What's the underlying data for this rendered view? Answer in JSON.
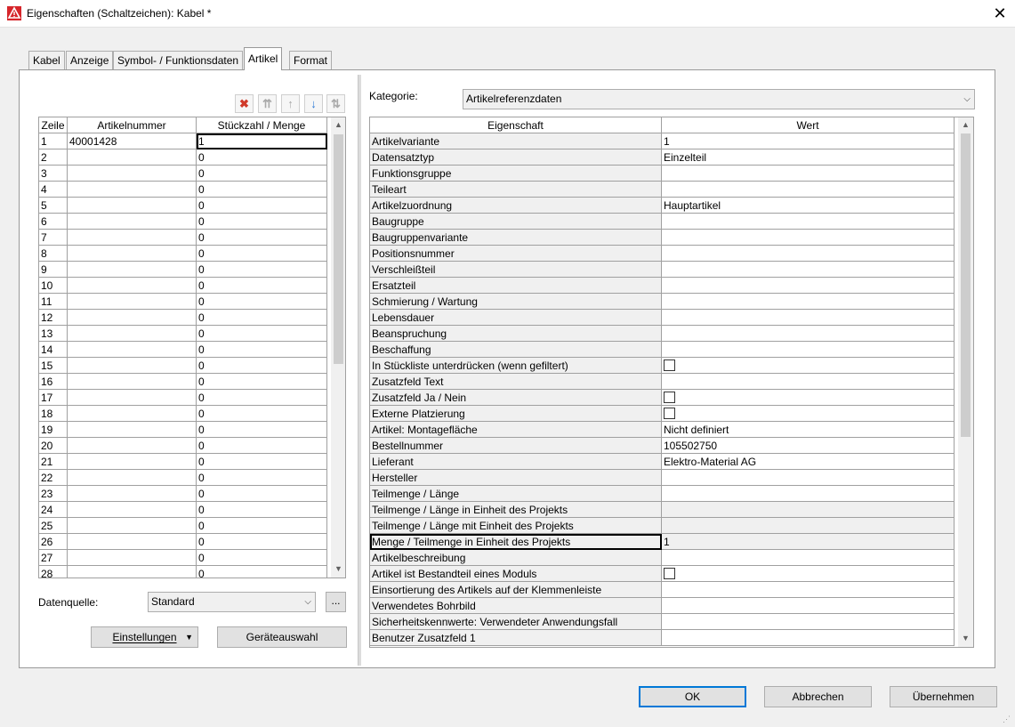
{
  "window": {
    "title": "Eigenschaften (Schaltzeichen): Kabel *",
    "close_glyph": "✕",
    "app_icon": "warning-triangle-icon"
  },
  "tabs": [
    {
      "label": "Kabel"
    },
    {
      "label": "Anzeige"
    },
    {
      "label": "Symbol- / Funktionsdaten"
    },
    {
      "label": "Artikel",
      "active": true
    },
    {
      "label": "Format"
    }
  ],
  "toolbar": {
    "delete_glyph": "✖",
    "move_top_glyph": "⇈",
    "move_up_glyph": "↑",
    "move_down_glyph": "↓",
    "swap_glyph": "⇅"
  },
  "article_grid": {
    "headers": [
      "Zeile",
      "Artikelnummer",
      "Stückzahl / Menge"
    ],
    "rows": [
      [
        "1",
        "40001428",
        "1"
      ],
      [
        "2",
        "",
        "0"
      ],
      [
        "3",
        "",
        "0"
      ],
      [
        "4",
        "",
        "0"
      ],
      [
        "5",
        "",
        "0"
      ],
      [
        "6",
        "",
        "0"
      ],
      [
        "7",
        "",
        "0"
      ],
      [
        "8",
        "",
        "0"
      ],
      [
        "9",
        "",
        "0"
      ],
      [
        "10",
        "",
        "0"
      ],
      [
        "11",
        "",
        "0"
      ],
      [
        "12",
        "",
        "0"
      ],
      [
        "13",
        "",
        "0"
      ],
      [
        "14",
        "",
        "0"
      ],
      [
        "15",
        "",
        "0"
      ],
      [
        "16",
        "",
        "0"
      ],
      [
        "17",
        "",
        "0"
      ],
      [
        "18",
        "",
        "0"
      ],
      [
        "19",
        "",
        "0"
      ],
      [
        "20",
        "",
        "0"
      ],
      [
        "21",
        "",
        "0"
      ],
      [
        "22",
        "",
        "0"
      ],
      [
        "23",
        "",
        "0"
      ],
      [
        "24",
        "",
        "0"
      ],
      [
        "25",
        "",
        "0"
      ],
      [
        "26",
        "",
        "0"
      ],
      [
        "27",
        "",
        "0"
      ],
      [
        "28",
        "",
        "0"
      ]
    ]
  },
  "datasource": {
    "label": "Datenquelle:",
    "value": "Standard",
    "browse_label": "..."
  },
  "buttons": {
    "settings": "Einstellungen",
    "device_selection": "Geräteauswahl",
    "ok": "OK",
    "cancel": "Abbrechen",
    "apply": "Übernehmen"
  },
  "category": {
    "label": "Kategorie:",
    "value": "Artikelreferenzdaten"
  },
  "property_grid": {
    "headers": [
      "Eigenschaft",
      "Wert"
    ],
    "rows": [
      {
        "name": "Artikelvariante",
        "value": "1"
      },
      {
        "name": "Datensatztyp",
        "value": "Einzelteil"
      },
      {
        "name": "Funktionsgruppe",
        "value": ""
      },
      {
        "name": "Teileart",
        "value": ""
      },
      {
        "name": "Artikelzuordnung",
        "value": "Hauptartikel"
      },
      {
        "name": "Baugruppe",
        "value": ""
      },
      {
        "name": "Baugruppenvariante",
        "value": ""
      },
      {
        "name": "Positionsnummer",
        "value": ""
      },
      {
        "name": "Verschleißteil",
        "value": ""
      },
      {
        "name": "Ersatzteil",
        "value": ""
      },
      {
        "name": "Schmierung / Wartung",
        "value": ""
      },
      {
        "name": "Lebensdauer",
        "value": ""
      },
      {
        "name": "Beanspruchung",
        "value": ""
      },
      {
        "name": "Beschaffung",
        "value": ""
      },
      {
        "name": "In Stückliste unterdrücken (wenn gefiltert)",
        "value": "",
        "checkbox": true,
        "checked": false
      },
      {
        "name": "Zusatzfeld Text",
        "value": ""
      },
      {
        "name": "Zusatzfeld Ja / Nein",
        "value": "",
        "checkbox": true,
        "checked": false
      },
      {
        "name": "Externe Platzierung",
        "value": "",
        "checkbox": true,
        "checked": false
      },
      {
        "name": "Artikel: Montagefläche",
        "value": "Nicht definiert"
      },
      {
        "name": "Bestellnummer",
        "value": "105502750"
      },
      {
        "name": "Lieferant",
        "value": "Elektro-Material AG"
      },
      {
        "name": "Hersteller",
        "value": ""
      },
      {
        "name": "Teilmenge / Länge",
        "value": ""
      },
      {
        "name": "Teilmenge / Länge in Einheit des Projekts",
        "value": "",
        "readonly": true
      },
      {
        "name": "Teilmenge / Länge mit Einheit des Projekts",
        "value": "",
        "readonly": true
      },
      {
        "name": "Menge / Teilmenge in Einheit des Projekts",
        "value": "1",
        "readonly": true,
        "focused": true
      },
      {
        "name": "Artikelbeschreibung",
        "value": ""
      },
      {
        "name": "Artikel ist Bestandteil eines Moduls",
        "value": "",
        "checkbox": true,
        "checked": false
      },
      {
        "name": "Einsortierung des Artikels auf der Klemmenleiste",
        "value": ""
      },
      {
        "name": "Verwendetes Bohrbild",
        "value": ""
      },
      {
        "name": "Sicherheitskennwerte: Verwendeter Anwendungsfall",
        "value": ""
      },
      {
        "name": "Benutzer Zusatzfeld 1",
        "value": ""
      }
    ]
  },
  "colors": {
    "delete_red": "#d03a2a",
    "move_down_blue": "#2f7bd6",
    "disabled_grey": "#a9a9a9",
    "default_button_border": "#0078d7"
  }
}
